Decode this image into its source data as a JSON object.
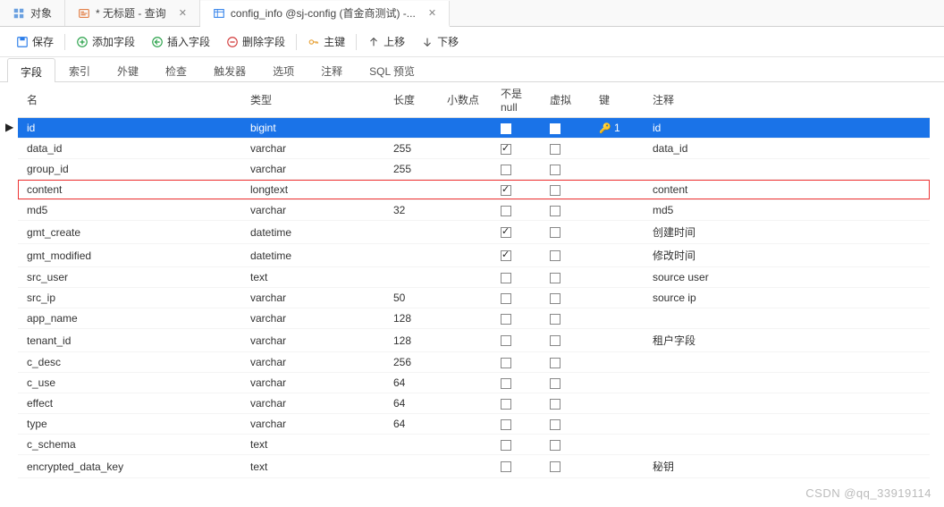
{
  "tabs": [
    {
      "label": "对象",
      "icon": "grid"
    },
    {
      "label": "* 无标题 - 查询",
      "icon": "sql",
      "closable": true
    },
    {
      "label": "config_info @sj-config (首金商测试) -...",
      "icon": "table",
      "closable": true,
      "active": true
    }
  ],
  "toolbar": {
    "save": "保存",
    "add_field": "添加字段",
    "insert_field": "插入字段",
    "delete_field": "删除字段",
    "primary_key": "主键",
    "move_up": "上移",
    "move_down": "下移"
  },
  "subtabs": [
    "字段",
    "索引",
    "外键",
    "检查",
    "触发器",
    "选项",
    "注释",
    "SQL 预览"
  ],
  "subtab_active": 0,
  "columns": {
    "name": "名",
    "type": "类型",
    "length": "长度",
    "decimal": "小数点",
    "notnull": "不是 null",
    "virtual": "虚拟",
    "key": "键",
    "comment": "注释"
  },
  "rows": [
    {
      "name": "id",
      "type": "bigint",
      "length": "",
      "decimal": "",
      "notnull": true,
      "virtual": false,
      "key": "1",
      "comment": "id",
      "selected": true
    },
    {
      "name": "data_id",
      "type": "varchar",
      "length": "255",
      "decimal": "",
      "notnull": true,
      "virtual": false,
      "key": "",
      "comment": "data_id"
    },
    {
      "name": "group_id",
      "type": "varchar",
      "length": "255",
      "decimal": "",
      "notnull": false,
      "virtual": false,
      "key": "",
      "comment": ""
    },
    {
      "name": "content",
      "type": "longtext",
      "length": "",
      "decimal": "",
      "notnull": true,
      "virtual": false,
      "key": "",
      "comment": "content",
      "highlight": true
    },
    {
      "name": "md5",
      "type": "varchar",
      "length": "32",
      "decimal": "",
      "notnull": false,
      "virtual": false,
      "key": "",
      "comment": "md5"
    },
    {
      "name": "gmt_create",
      "type": "datetime",
      "length": "",
      "decimal": "",
      "notnull": true,
      "virtual": false,
      "key": "",
      "comment": "创建时间"
    },
    {
      "name": "gmt_modified",
      "type": "datetime",
      "length": "",
      "decimal": "",
      "notnull": true,
      "virtual": false,
      "key": "",
      "comment": "修改时间"
    },
    {
      "name": "src_user",
      "type": "text",
      "length": "",
      "decimal": "",
      "notnull": false,
      "virtual": false,
      "key": "",
      "comment": "source user"
    },
    {
      "name": "src_ip",
      "type": "varchar",
      "length": "50",
      "decimal": "",
      "notnull": false,
      "virtual": false,
      "key": "",
      "comment": "source ip"
    },
    {
      "name": "app_name",
      "type": "varchar",
      "length": "128",
      "decimal": "",
      "notnull": false,
      "virtual": false,
      "key": "",
      "comment": ""
    },
    {
      "name": "tenant_id",
      "type": "varchar",
      "length": "128",
      "decimal": "",
      "notnull": false,
      "virtual": false,
      "key": "",
      "comment": "租户字段"
    },
    {
      "name": "c_desc",
      "type": "varchar",
      "length": "256",
      "decimal": "",
      "notnull": false,
      "virtual": false,
      "key": "",
      "comment": ""
    },
    {
      "name": "c_use",
      "type": "varchar",
      "length": "64",
      "decimal": "",
      "notnull": false,
      "virtual": false,
      "key": "",
      "comment": ""
    },
    {
      "name": "effect",
      "type": "varchar",
      "length": "64",
      "decimal": "",
      "notnull": false,
      "virtual": false,
      "key": "",
      "comment": ""
    },
    {
      "name": "type",
      "type": "varchar",
      "length": "64",
      "decimal": "",
      "notnull": false,
      "virtual": false,
      "key": "",
      "comment": ""
    },
    {
      "name": "c_schema",
      "type": "text",
      "length": "",
      "decimal": "",
      "notnull": false,
      "virtual": false,
      "key": "",
      "comment": ""
    },
    {
      "name": "encrypted_data_key",
      "type": "text",
      "length": "",
      "decimal": "",
      "notnull": false,
      "virtual": false,
      "key": "",
      "comment": "秘钥"
    }
  ],
  "watermark": "CSDN @qq_33919114"
}
